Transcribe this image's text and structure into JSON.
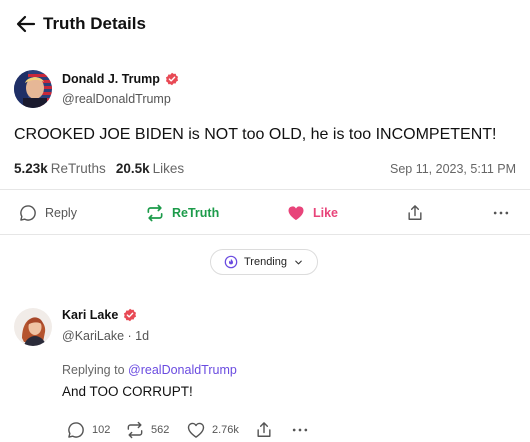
{
  "header": {
    "title": "Truth Details",
    "back_icon": "arrow-left-icon"
  },
  "post": {
    "author": {
      "name": "Donald J. Trump",
      "handle": "@realDonaldTrump",
      "verified": true
    },
    "text": "CROOKED JOE BIDEN is NOT too OLD, he is too INCOMPETENT!",
    "stats": {
      "retruths_count": "5.23k",
      "retruths_label": "ReTruths",
      "likes_count": "20.5k",
      "likes_label": "Likes"
    },
    "date": "Sep 11, 2023, 5:11 PM",
    "actions": {
      "reply": "Reply",
      "retruth": "ReTruth",
      "like": "Like"
    }
  },
  "sort": {
    "label": "Trending"
  },
  "reply": {
    "author": {
      "name": "Kari Lake",
      "handle": "@KariLake",
      "time": "1d",
      "verified": true
    },
    "replying_prefix": "Replying to",
    "replying_to": "@realDonaldTrump",
    "text": "And TOO CORRUPT!",
    "actions": {
      "replies": "102",
      "retruths": "562",
      "likes": "2.76k"
    }
  },
  "colors": {
    "accent": "#6a4be0",
    "retruth_green": "#1c9b4a",
    "like_pink": "#e8447a",
    "verified_red": "#e84a55"
  }
}
